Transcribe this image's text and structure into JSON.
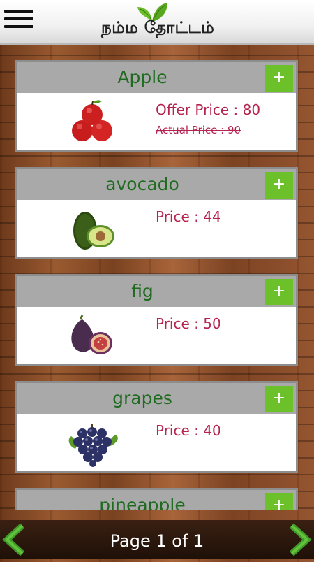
{
  "app": {
    "title": "நம்ம தோட்டம்"
  },
  "products": [
    {
      "name": "Apple",
      "icon": "apple-icon",
      "price_text": "Offer Price : 80",
      "actual_price_text": "Actual Price : 90"
    },
    {
      "name": "avocado",
      "icon": "avocado-icon",
      "price_text": "Price : 44"
    },
    {
      "name": "fig",
      "icon": "fig-icon",
      "price_text": "Price : 50"
    },
    {
      "name": "grapes",
      "icon": "grapes-icon",
      "price_text": "Price : 40"
    },
    {
      "name": "pineapple",
      "icon": "pineapple-icon"
    }
  ],
  "add_label": "+",
  "pagination": {
    "label": "Page 1 of 1",
    "current": 1,
    "total": 1
  },
  "colors": {
    "accent_green": "#6cc02a",
    "title_green": "#1f6b20",
    "price_magenta": "#b5234f",
    "card_header_gray": "#a9a9a9"
  }
}
